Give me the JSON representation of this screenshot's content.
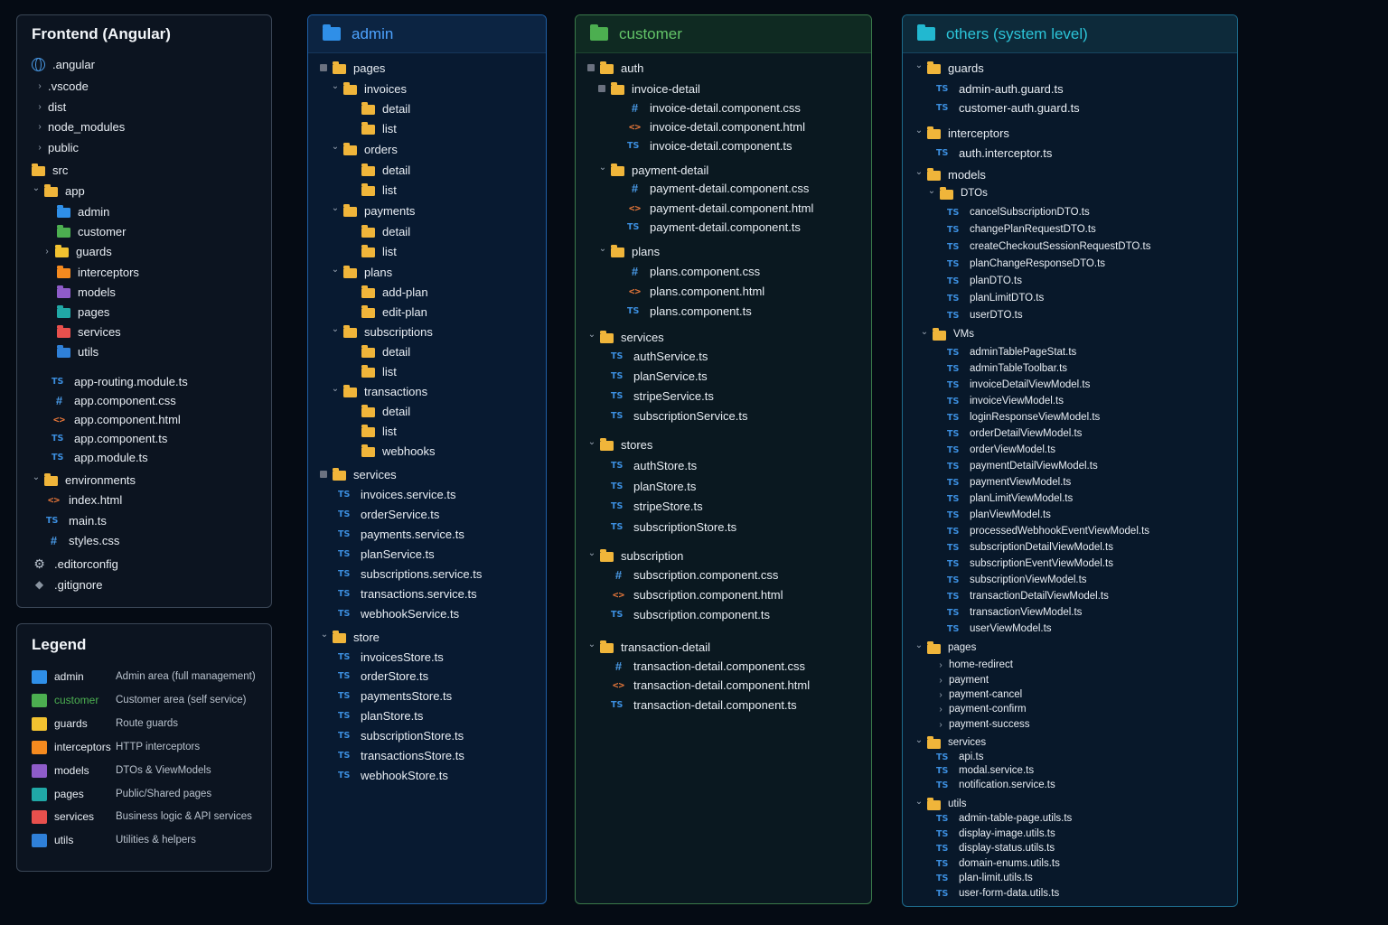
{
  "colors": {
    "admin": "#2f8fe8",
    "customer": "#4caf50",
    "guards": "#f2c230",
    "interceptors": "#f58a1f",
    "models": "#8e5cc9",
    "pages": "#20a8a6",
    "services": "#e8504d",
    "utils": "#2f80d8",
    "folder": "#f0b53a"
  },
  "frontend": {
    "title": "Frontend (Angular)",
    "items": [
      {
        "label": ".angular",
        "icon": "globe-icon",
        "chev": ""
      },
      {
        "label": ".vscode",
        "icon": "",
        "chev": "›"
      },
      {
        "label": "dist",
        "icon": "",
        "chev": "›"
      },
      {
        "label": "node_modules",
        "icon": "",
        "chev": "›"
      },
      {
        "label": "public",
        "icon": "",
        "chev": "›"
      },
      {
        "label": "src",
        "icon": "folder-icon",
        "chev": ""
      },
      {
        "label": "app",
        "icon": "folder-icon",
        "chev": "⌄"
      },
      {
        "label": "admin",
        "icon": "admin-folder-icon",
        "chev": ""
      },
      {
        "label": "customer",
        "icon": "customer-folder-icon",
        "chev": ""
      },
      {
        "label": "guards",
        "icon": "guards-folder-icon",
        "chev": "›"
      },
      {
        "label": "interceptors",
        "icon": "interceptors-folder-icon",
        "chev": ""
      },
      {
        "label": "models",
        "icon": "models-folder-icon",
        "chev": ""
      },
      {
        "label": "pages",
        "icon": "pages-folder-icon",
        "chev": ""
      },
      {
        "label": "services",
        "icon": "services-folder-icon",
        "chev": ""
      },
      {
        "label": "utils",
        "icon": "utils-folder-icon",
        "chev": ""
      },
      {
        "label": "app-routing.module.ts",
        "icon": "ts-icon",
        "chev": ""
      },
      {
        "label": "app.component.css",
        "icon": "css-icon",
        "chev": ""
      },
      {
        "label": "app.component.html",
        "icon": "html-icon",
        "chev": ""
      },
      {
        "label": "app.component.ts",
        "icon": "ts-icon",
        "chev": ""
      },
      {
        "label": "app.module.ts",
        "icon": "ts-icon",
        "chev": ""
      },
      {
        "label": "environments",
        "icon": "folder-icon",
        "chev": "⌄"
      },
      {
        "label": "index.html",
        "icon": "html-icon",
        "chev": ""
      },
      {
        "label": "main.ts",
        "icon": "ts-icon",
        "chev": ""
      },
      {
        "label": "styles.css",
        "icon": "css-icon",
        "chev": ""
      },
      {
        "label": ".editorconfig",
        "icon": "gear-icon",
        "chev": ""
      },
      {
        "label": ".gitignore",
        "icon": "git-icon",
        "chev": ""
      }
    ]
  },
  "legend": {
    "title": "Legend",
    "items": [
      {
        "name": "admin",
        "desc": "Admin area (full management)"
      },
      {
        "name": "customer",
        "desc": "Customer area (self service)"
      },
      {
        "name": "guards",
        "desc": "Route guards"
      },
      {
        "name": "interceptors",
        "desc": "HTTP interceptors"
      },
      {
        "name": "models",
        "desc": "DTOs & ViewModels"
      },
      {
        "name": "pages",
        "desc": "Public/Shared pages"
      },
      {
        "name": "services",
        "desc": "Business logic & API services"
      },
      {
        "name": "utils",
        "desc": "Utilities & helpers"
      }
    ]
  },
  "admin": {
    "title": "admin",
    "items": [
      {
        "label": "pages",
        "icon": "folder-icon",
        "chev": "▣"
      },
      {
        "label": "invoices",
        "icon": "folder-icon",
        "chev": "⌄"
      },
      {
        "label": "detail",
        "icon": "folder-icon",
        "chev": ""
      },
      {
        "label": "list",
        "icon": "folder-icon",
        "chev": ""
      },
      {
        "label": "orders",
        "icon": "folder-icon",
        "chev": "⌄"
      },
      {
        "label": "detail",
        "icon": "folder-icon",
        "chev": ""
      },
      {
        "label": "list",
        "icon": "folder-icon",
        "chev": ""
      },
      {
        "label": "payments",
        "icon": "folder-icon",
        "chev": "⌄"
      },
      {
        "label": "detail",
        "icon": "folder-icon",
        "chev": ""
      },
      {
        "label": "list",
        "icon": "folder-icon",
        "chev": ""
      },
      {
        "label": "plans",
        "icon": "folder-icon",
        "chev": "⌄"
      },
      {
        "label": "add-plan",
        "icon": "folder-icon",
        "chev": ""
      },
      {
        "label": "edit-plan",
        "icon": "folder-icon",
        "chev": ""
      },
      {
        "label": "subscriptions",
        "icon": "folder-icon",
        "chev": "⌄"
      },
      {
        "label": "detail",
        "icon": "folder-icon",
        "chev": ""
      },
      {
        "label": "list",
        "icon": "folder-icon",
        "chev": ""
      },
      {
        "label": "transactions",
        "icon": "folder-icon",
        "chev": "⌄"
      },
      {
        "label": "detail",
        "icon": "folder-icon",
        "chev": ""
      },
      {
        "label": "list",
        "icon": "folder-icon",
        "chev": ""
      },
      {
        "label": "webhooks",
        "icon": "folder-icon",
        "chev": ""
      },
      {
        "label": "services",
        "icon": "folder-icon",
        "chev": "▣"
      },
      {
        "label": "invoices.service.ts",
        "icon": "ts-icon",
        "chev": ""
      },
      {
        "label": "orderService.ts",
        "icon": "ts-icon",
        "chev": ""
      },
      {
        "label": "payments.service.ts",
        "icon": "ts-icon",
        "chev": ""
      },
      {
        "label": "planService.ts",
        "icon": "ts-icon",
        "chev": ""
      },
      {
        "label": "subscriptions.service.ts",
        "icon": "ts-icon",
        "chev": ""
      },
      {
        "label": "transactions.service.ts",
        "icon": "ts-icon",
        "chev": ""
      },
      {
        "label": "webhookService.ts",
        "icon": "ts-icon",
        "chev": ""
      },
      {
        "label": "store",
        "icon": "folder-icon",
        "chev": "⌄"
      },
      {
        "label": "invoicesStore.ts",
        "icon": "ts-icon",
        "chev": ""
      },
      {
        "label": "orderStore.ts",
        "icon": "ts-icon",
        "chev": ""
      },
      {
        "label": "paymentsStore.ts",
        "icon": "ts-icon",
        "chev": ""
      },
      {
        "label": "planStore.ts",
        "icon": "ts-icon",
        "chev": ""
      },
      {
        "label": "subscriptionStore.ts",
        "icon": "ts-icon",
        "chev": ""
      },
      {
        "label": "transactionsStore.ts",
        "icon": "ts-icon",
        "chev": ""
      },
      {
        "label": "webhookStore.ts",
        "icon": "ts-icon",
        "chev": ""
      }
    ]
  },
  "customer": {
    "title": "customer",
    "items": [
      {
        "label": "auth",
        "icon": "folder-icon",
        "chev": "▣"
      },
      {
        "label": "invoice-detail",
        "icon": "folder-icon",
        "chev": "▣"
      },
      {
        "label": "invoice-detail.component.css",
        "icon": "css-icon",
        "chev": ""
      },
      {
        "label": "invoice-detail.component.html",
        "icon": "html-icon",
        "chev": ""
      },
      {
        "label": "invoice-detail.component.ts",
        "icon": "ts-icon",
        "chev": ""
      },
      {
        "label": "payment-detail",
        "icon": "folder-icon",
        "chev": "⌄"
      },
      {
        "label": "payment-detail.component.css",
        "icon": "css-icon",
        "chev": ""
      },
      {
        "label": "payment-detail.component.html",
        "icon": "html-icon",
        "chev": ""
      },
      {
        "label": "payment-detail.component.ts",
        "icon": "ts-icon",
        "chev": ""
      },
      {
        "label": "plans",
        "icon": "folder-icon",
        "chev": "⌄"
      },
      {
        "label": "plans.component.css",
        "icon": "css-icon",
        "chev": ""
      },
      {
        "label": "plans.component.html",
        "icon": "html-icon",
        "chev": ""
      },
      {
        "label": "plans.component.ts",
        "icon": "ts-icon",
        "chev": ""
      },
      {
        "label": "services",
        "icon": "folder-icon",
        "chev": "⌄"
      },
      {
        "label": "authService.ts",
        "icon": "ts-icon",
        "chev": ""
      },
      {
        "label": "planService.ts",
        "icon": "ts-icon",
        "chev": ""
      },
      {
        "label": "stripeService.ts",
        "icon": "ts-icon",
        "chev": ""
      },
      {
        "label": "subscriptionService.ts",
        "icon": "ts-icon",
        "chev": ""
      },
      {
        "label": "stores",
        "icon": "folder-icon",
        "chev": "⌄"
      },
      {
        "label": "authStore.ts",
        "icon": "ts-icon",
        "chev": ""
      },
      {
        "label": "planStore.ts",
        "icon": "ts-icon",
        "chev": ""
      },
      {
        "label": "stripeStore.ts",
        "icon": "ts-icon",
        "chev": ""
      },
      {
        "label": "subscriptionStore.ts",
        "icon": "ts-icon",
        "chev": ""
      },
      {
        "label": "subscription",
        "icon": "folder-icon",
        "chev": "⌄"
      },
      {
        "label": "subscription.component.css",
        "icon": "css-icon",
        "chev": ""
      },
      {
        "label": "subscription.component.html",
        "icon": "html-icon",
        "chev": ""
      },
      {
        "label": "subscription.component.ts",
        "icon": "ts-icon",
        "chev": ""
      },
      {
        "label": "transaction-detail",
        "icon": "folder-icon",
        "chev": "⌄"
      },
      {
        "label": "transaction-detail.component.css",
        "icon": "css-icon",
        "chev": ""
      },
      {
        "label": "transaction-detail.component.html",
        "icon": "html-icon",
        "chev": ""
      },
      {
        "label": "transaction-detail.component.ts",
        "icon": "ts-icon",
        "chev": ""
      }
    ]
  },
  "others": {
    "title": "others (system level)",
    "items": [
      {
        "label": "guards",
        "icon": "folder-icon",
        "chev": "⌄"
      },
      {
        "label": "admin-auth.guard.ts",
        "icon": "ts-icon",
        "chev": ""
      },
      {
        "label": "customer-auth.guard.ts",
        "icon": "ts-icon",
        "chev": ""
      },
      {
        "label": "interceptors",
        "icon": "folder-icon",
        "chev": "⌄"
      },
      {
        "label": "auth.interceptor.ts",
        "icon": "ts-icon",
        "chev": ""
      },
      {
        "label": "models",
        "icon": "folder-icon",
        "chev": "⌄"
      },
      {
        "label": "DTOs",
        "icon": "folder-icon",
        "chev": "⌄"
      },
      {
        "label": "cancelSubscriptionDTO.ts",
        "icon": "ts-icon",
        "chev": ""
      },
      {
        "label": "changePlanRequestDTO.ts",
        "icon": "ts-icon",
        "chev": ""
      },
      {
        "label": "createCheckoutSessionRequestDTO.ts",
        "icon": "ts-icon",
        "chev": ""
      },
      {
        "label": "planChangeResponseDTO.ts",
        "icon": "ts-icon",
        "chev": ""
      },
      {
        "label": "planDTO.ts",
        "icon": "ts-icon",
        "chev": ""
      },
      {
        "label": "planLimitDTO.ts",
        "icon": "ts-icon",
        "chev": ""
      },
      {
        "label": "userDTO.ts",
        "icon": "ts-icon",
        "chev": ""
      },
      {
        "label": "VMs",
        "icon": "folder-icon",
        "chev": "⌄"
      },
      {
        "label": "adminTablePageStat.ts",
        "icon": "ts-icon",
        "chev": ""
      },
      {
        "label": "adminTableToolbar.ts",
        "icon": "ts-icon",
        "chev": ""
      },
      {
        "label": "invoiceDetailViewModel.ts",
        "icon": "ts-icon",
        "chev": ""
      },
      {
        "label": "invoiceViewModel.ts",
        "icon": "ts-icon",
        "chev": ""
      },
      {
        "label": "loginResponseViewModel.ts",
        "icon": "ts-icon",
        "chev": ""
      },
      {
        "label": "orderDetailViewModel.ts",
        "icon": "ts-icon",
        "chev": ""
      },
      {
        "label": "orderViewModel.ts",
        "icon": "ts-icon",
        "chev": ""
      },
      {
        "label": "paymentDetailViewModel.ts",
        "icon": "ts-icon",
        "chev": ""
      },
      {
        "label": "paymentViewModel.ts",
        "icon": "ts-icon",
        "chev": ""
      },
      {
        "label": "planLimitViewModel.ts",
        "icon": "ts-icon",
        "chev": ""
      },
      {
        "label": "planViewModel.ts",
        "icon": "ts-icon",
        "chev": ""
      },
      {
        "label": "processedWebhookEventViewModel.ts",
        "icon": "ts-icon",
        "chev": ""
      },
      {
        "label": "subscriptionDetailViewModel.ts",
        "icon": "ts-icon",
        "chev": ""
      },
      {
        "label": "subscriptionEventViewModel.ts",
        "icon": "ts-icon",
        "chev": ""
      },
      {
        "label": "subscriptionViewModel.ts",
        "icon": "ts-icon",
        "chev": ""
      },
      {
        "label": "transactionDetailViewModel.ts",
        "icon": "ts-icon",
        "chev": ""
      },
      {
        "label": "transactionViewModel.ts",
        "icon": "ts-icon",
        "chev": ""
      },
      {
        "label": "userViewModel.ts",
        "icon": "ts-icon",
        "chev": ""
      },
      {
        "label": "pages",
        "icon": "folder-icon",
        "chev": "⌄"
      },
      {
        "label": "home-redirect",
        "icon": "",
        "chev": "›"
      },
      {
        "label": "payment",
        "icon": "",
        "chev": "›"
      },
      {
        "label": "payment-cancel",
        "icon": "",
        "chev": "›"
      },
      {
        "label": "payment-confirm",
        "icon": "",
        "chev": "›"
      },
      {
        "label": "payment-success",
        "icon": "",
        "chev": "›"
      },
      {
        "label": "services",
        "icon": "folder-icon",
        "chev": "⌄"
      },
      {
        "label": "api.ts",
        "icon": "ts-icon",
        "chev": ""
      },
      {
        "label": "modal.service.ts",
        "icon": "ts-icon",
        "chev": ""
      },
      {
        "label": "notification.service.ts",
        "icon": "ts-icon",
        "chev": ""
      },
      {
        "label": "utils",
        "icon": "folder-icon",
        "chev": "⌄"
      },
      {
        "label": "admin-table-page.utils.ts",
        "icon": "ts-icon",
        "chev": ""
      },
      {
        "label": "display-image.utils.ts",
        "icon": "ts-icon",
        "chev": ""
      },
      {
        "label": "display-status.utils.ts",
        "icon": "ts-icon",
        "chev": ""
      },
      {
        "label": "domain-enums.utils.ts",
        "icon": "ts-icon",
        "chev": ""
      },
      {
        "label": "plan-limit.utils.ts",
        "icon": "ts-icon",
        "chev": ""
      },
      {
        "label": "user-form-data.utils.ts",
        "icon": "ts-icon",
        "chev": ""
      }
    ]
  }
}
